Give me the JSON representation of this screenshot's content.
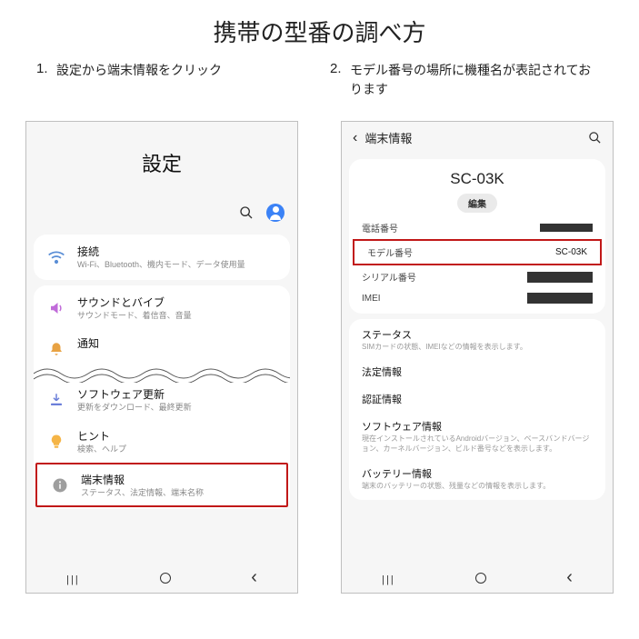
{
  "title": "携帯の型番の調べ方",
  "steps": [
    {
      "num": "1.",
      "text": "設定から端末情報をクリック"
    },
    {
      "num": "2.",
      "text": "モデル番号の場所に機種名が表記されております"
    }
  ],
  "phone1": {
    "header": "設定",
    "rows": {
      "connections": {
        "title": "接続",
        "sub": "Wi-Fi、Bluetooth、機内モード、データ使用量"
      },
      "sound": {
        "title": "サウンドとバイブ",
        "sub": "サウンドモード、着信音、音量"
      },
      "notif": {
        "title": "通知",
        "sub": ""
      },
      "software": {
        "title": "ソフトウェア更新",
        "sub": "更新をダウンロード、最終更新"
      },
      "hint": {
        "title": "ヒント",
        "sub": "検索、ヘルプ"
      },
      "about": {
        "title": "端末情報",
        "sub": "ステータス、法定情報、端末名称"
      }
    }
  },
  "phone2": {
    "topbar_title": "端末情報",
    "model": "SC-03K",
    "edit_label": "編集",
    "kv": {
      "phone": {
        "label": "電話番号"
      },
      "model": {
        "label": "モデル番号",
        "value": "SC-03K"
      },
      "serial": {
        "label": "シリアル番号"
      },
      "imei": {
        "label": "IMEI"
      }
    },
    "sections": {
      "status": {
        "title": "ステータス",
        "sub": "SIMカードの状態、IMEIなどの情報を表示します。"
      },
      "legal": {
        "title": "法定情報"
      },
      "cert": {
        "title": "認証情報"
      },
      "software": {
        "title": "ソフトウェア情報",
        "sub": "現在インストールされているAndroidバージョン、ベースバンドバージョン、カーネルバージョン、ビルド番号などを表示します。"
      },
      "battery": {
        "title": "バッテリー情報",
        "sub": "端末のバッテリーの状態、残量などの情報を表示します。"
      }
    }
  }
}
